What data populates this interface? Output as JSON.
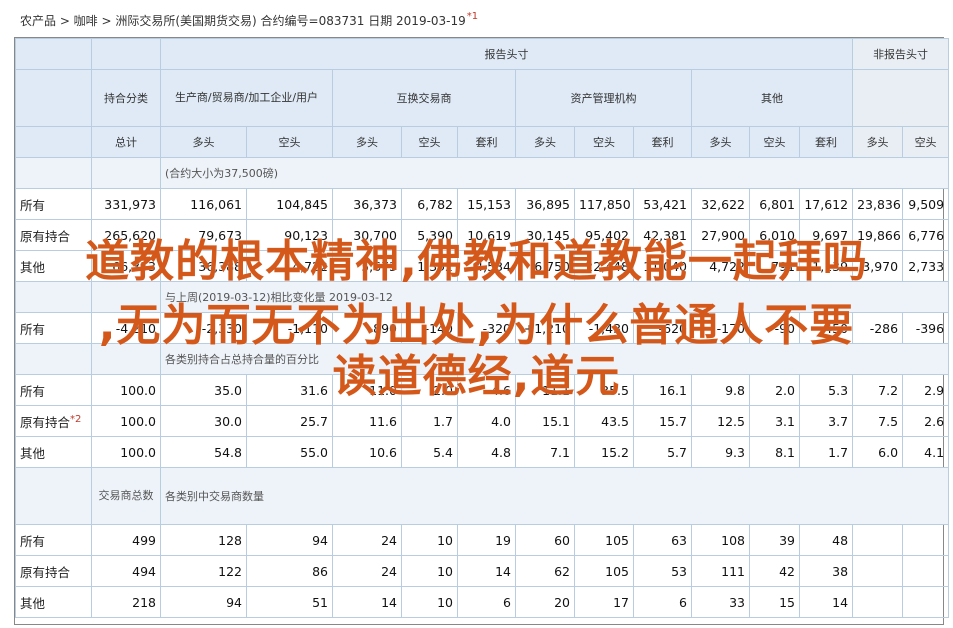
{
  "header_line": {
    "text": "农产品 > 咖啡 > 洲际交易所(美国期货交易) 合约编号=083731 日期 2019-03-19",
    "footnote": "*1"
  },
  "table": {
    "group_reportable": "报告头寸",
    "group_nonreportable": "非报告头寸",
    "col_category": "持合分类",
    "col_producer": "生产商/贸易商/加工企业/用户",
    "col_swap": "互换交易商",
    "col_managed": "资产管理机构",
    "col_other": "其他",
    "sub_total": "总计",
    "sub_long": "多头",
    "sub_short": "空头",
    "sub_spread": "套利",
    "sec1": "(合约大小为37,500磅)",
    "sec2": "与上周(2019-03-12)相比变化量 2019-03-12",
    "sec3": "各类别持合占总持合量的百分比",
    "sec4_left": "交易商总数",
    "sec4": "各类别中交易商数量",
    "rows_pos": [
      {
        "label": "所有",
        "v": [
          "331,973",
          "116,061",
          "104,845",
          "36,373",
          "6,782",
          "15,153",
          "36,895",
          "117,850",
          "53,421",
          "32,622",
          "6,801",
          "17,612",
          "23,836",
          "9,509"
        ]
      },
      {
        "label": "原有持合",
        "v": [
          "265,620",
          "79,673",
          "90,123",
          "30,700",
          "5,390",
          "10,619",
          "30,145",
          "95,402",
          "42,381",
          "27,900",
          "6,010",
          "9,697",
          "19,866",
          "6,776"
        ]
      },
      {
        "label": "其他",
        "v": [
          "66,353",
          "36,388",
          "14,722",
          "5,673",
          "1,392",
          "4,534",
          "6,750",
          "22,448",
          "11,040",
          "4,722",
          "791",
          "1,139",
          "3,970",
          "2,733"
        ]
      }
    ],
    "rows_chg": [
      {
        "label": "所有",
        "v": [
          "-4,210",
          "-2,330",
          "-1,110",
          "-890",
          "-140",
          "-320",
          "+1,210",
          "-1,430",
          "-620",
          "-170",
          "-90",
          "-450",
          "-286",
          "-396"
        ]
      }
    ],
    "rows_pct": [
      {
        "label": "所有",
        "v": [
          "100.0",
          "35.0",
          "31.6",
          "11.0",
          "2.0",
          "4.6",
          "11.1",
          "35.5",
          "16.1",
          "9.8",
          "2.0",
          "5.3",
          "7.2",
          "2.9"
        ]
      },
      {
        "label": "原有持合",
        "footnote": "*2",
        "v": [
          "100.0",
          "30.0",
          "25.7",
          "11.6",
          "1.7",
          "4.0",
          "15.1",
          "43.5",
          "15.7",
          "12.5",
          "3.1",
          "3.7",
          "7.5",
          "2.6"
        ]
      },
      {
        "label": "其他",
        "v": [
          "100.0",
          "54.8",
          "55.0",
          "10.6",
          "5.4",
          "4.8",
          "7.1",
          "15.2",
          "5.7",
          "9.3",
          "8.1",
          "1.7",
          "6.0",
          "4.1"
        ]
      }
    ],
    "rows_cnt": [
      {
        "label": "所有",
        "v": [
          "499",
          "128",
          "94",
          "24",
          "10",
          "19",
          "60",
          "105",
          "63",
          "108",
          "39",
          "48",
          "",
          ""
        ]
      },
      {
        "label": "原有持合",
        "v": [
          "494",
          "122",
          "86",
          "24",
          "10",
          "14",
          "62",
          "105",
          "53",
          "111",
          "42",
          "38",
          "",
          ""
        ]
      },
      {
        "label": "其他",
        "v": [
          "218",
          "94",
          "51",
          "14",
          "10",
          "6",
          "20",
          "17",
          "6",
          "33",
          "15",
          "14",
          "",
          ""
        ]
      }
    ]
  },
  "overlay": {
    "line1": "道教的根本精神,佛教和道教能一起拜吗",
    "line2": ",无为而无不为出处,为什么普通人不要",
    "line3": "读道德经,道元"
  }
}
